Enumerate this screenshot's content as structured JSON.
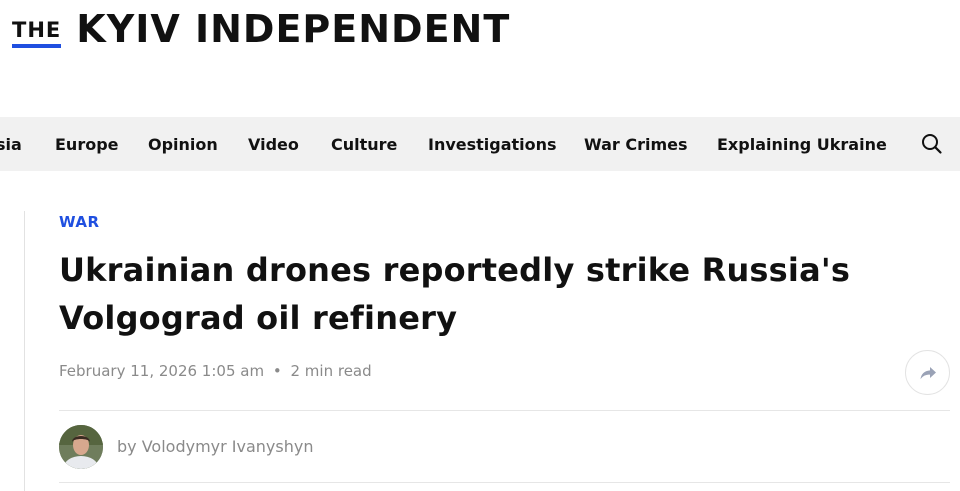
{
  "masthead": {
    "the": "THE",
    "name": "KYIV INDEPENDENT"
  },
  "nav": {
    "items": [
      {
        "label": "sia"
      },
      {
        "label": "Europe"
      },
      {
        "label": "Opinion"
      },
      {
        "label": "Video"
      },
      {
        "label": "Culture"
      },
      {
        "label": "Investigations"
      },
      {
        "label": "War Crimes"
      },
      {
        "label": "Explaining Ukraine"
      }
    ],
    "search_icon": "search-icon"
  },
  "article": {
    "category": "WAR",
    "headline_line1": "Ukrainian drones reportedly strike Russia's",
    "headline_line2": "Volgograd oil refinery",
    "date": "February 11, 2026 1:05 am",
    "separator": "•",
    "read_time": "2 min read",
    "share_icon": "share-arrow-icon",
    "byline": "by Volodymyr Ivanyshyn"
  },
  "colors": {
    "accent": "#1f4fe0",
    "nav_background": "#f1f1f1",
    "meta_text": "#8a8a8a"
  }
}
